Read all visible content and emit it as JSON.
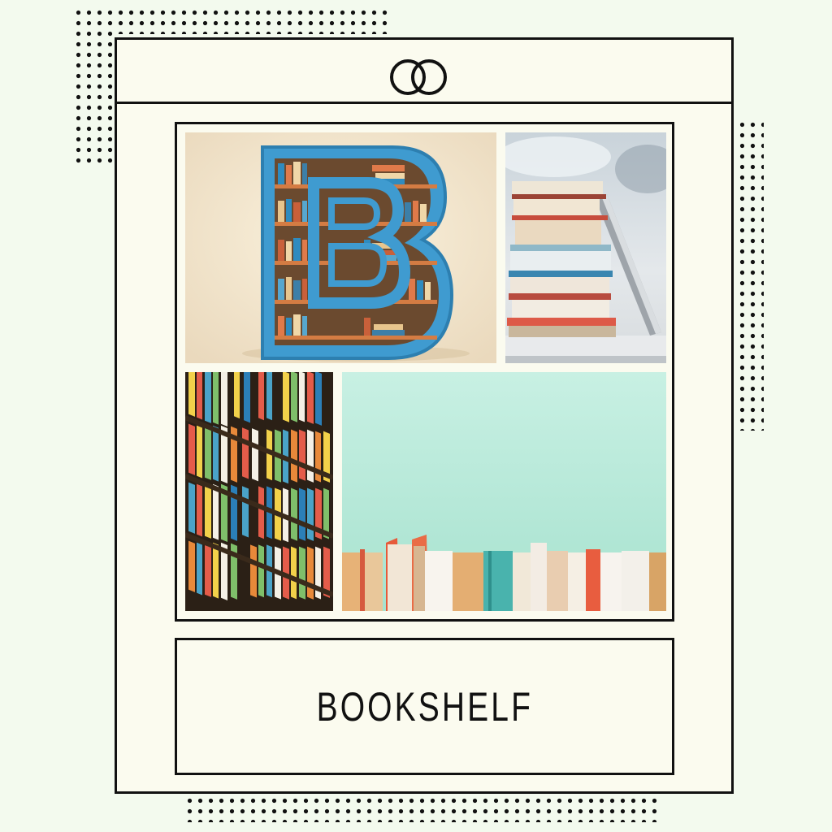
{
  "page": {
    "title": "BOOKSHELF",
    "logo_icon": "interlocking-rings-icon",
    "background_color": "#f3faee",
    "card_color": "#fbfbef",
    "border_color": "#111111"
  },
  "gallery": {
    "photos": [
      {
        "name": "letter-b-bookshelf-photo",
        "monogram": "B",
        "color": "#3f9bd0"
      },
      {
        "name": "book-stack-laptop-photo"
      },
      {
        "name": "library-shelves-photo"
      },
      {
        "name": "books-row-mint-wall-photo",
        "color": "#bfeee0"
      }
    ]
  }
}
